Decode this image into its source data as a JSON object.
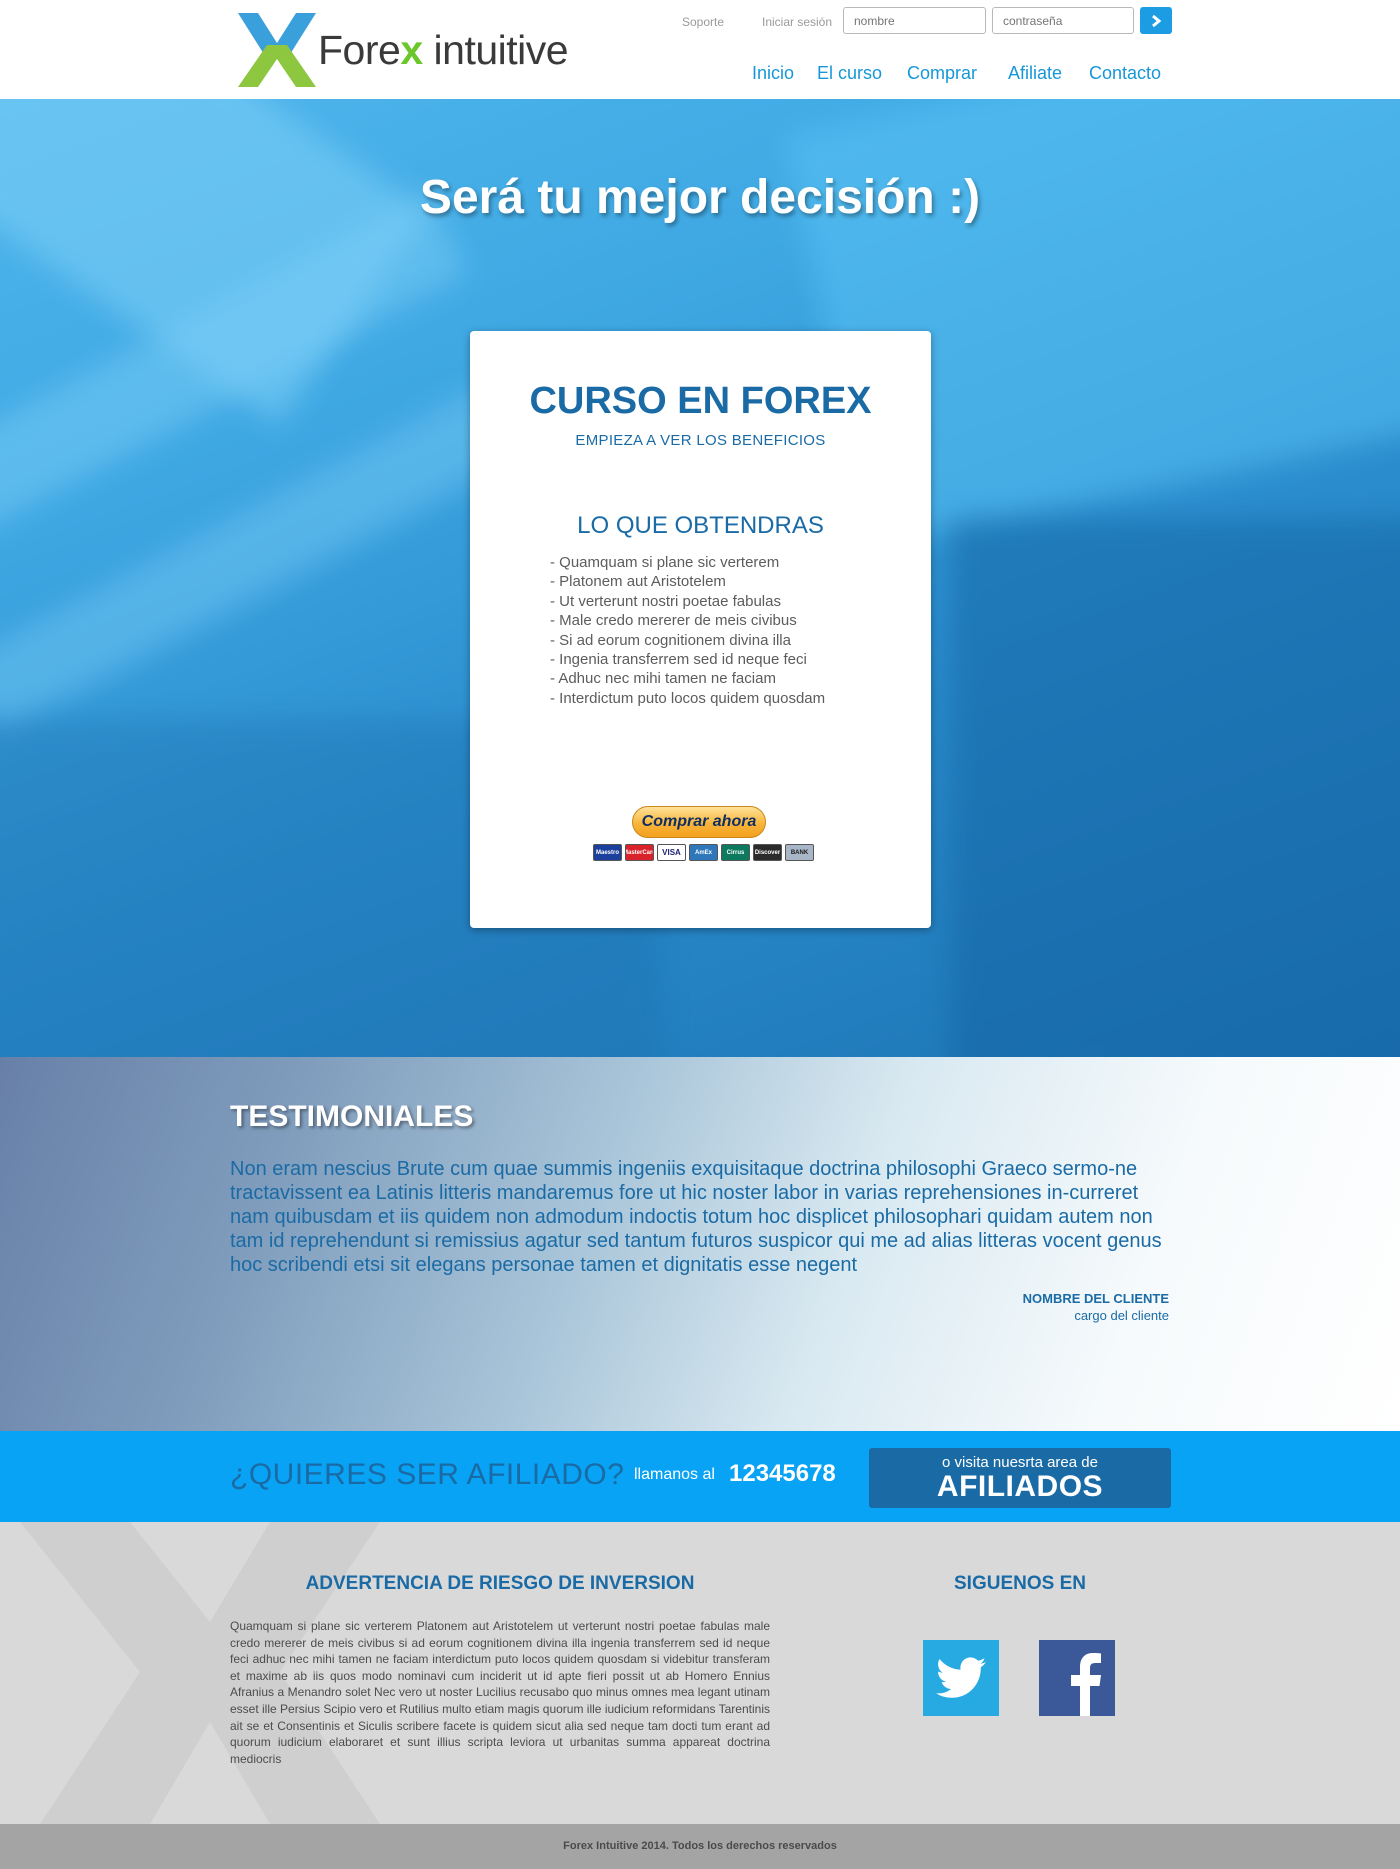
{
  "brand": {
    "logo_word": "Forex",
    "logo_word2": "intuitive",
    "colors": {
      "blue": "#1a6ba5",
      "accent": "#08a3f4",
      "green": "#6bc72b"
    }
  },
  "header": {
    "support": "Soporte",
    "login_label": "Iniciar sesión",
    "username_placeholder": "nombre",
    "password_placeholder": "contraseña",
    "submit_icon": "chevron-right-icon",
    "nav": [
      "Inicio",
      "El curso",
      "Comprar",
      "Afiliate",
      "Contacto"
    ]
  },
  "hero": {
    "title": "Será tu mejor decisión :)",
    "card": {
      "title": "CURSO EN FOREX",
      "subtitle": "EMPIEZA A VER LOS BENEFICIOS",
      "list_title": "LO QUE OBTENDRAS",
      "items": [
        "- Quamquam si plane sic verterem",
        "- Platonem aut Aristotelem",
        "- Ut verterunt nostri poetae fabulas",
        "- Male credo mererer de meis civibus",
        "- Si ad eorum cognitionem divina illa",
        "- Ingenia transferrem sed id neque feci",
        "- Adhuc nec mihi tamen ne faciam",
        "- Interdictum puto locos quidem quosdam"
      ],
      "buy_button": "Comprar ahora",
      "payment_cards": [
        "Maestro",
        "MasterCard",
        "VISA",
        "AmEx",
        "Cirrus",
        "Discover",
        "BANK"
      ]
    }
  },
  "testimonials": {
    "title": "TESTIMONIALES",
    "text": "Non eram nescius Brute cum quae summis ingeniis exquisitaque doctrina philosophi Graeco sermo-ne tractavissent ea Latinis litteris mandaremus fore ut hic noster labor in varias reprehensiones in-curreret nam quibusdam et iis quidem non admodum indoctis totum hoc displicet philosophari quidam autem non tam id reprehendunt si remissius agatur sed tantum futuros suspicor qui me ad alias litteras vocent genus hoc scribendi etsi sit elegans personae tamen et dignitatis esse negent",
    "client_name": "NOMBRE DEL CLIENTE",
    "client_role": "cargo del cliente"
  },
  "affiliate": {
    "question": "¿QUIERES SER AFILIADO?",
    "call_label": "llamanos al",
    "phone": "12345678",
    "visit_small": "o visita nuesrta area de",
    "visit_big": "AFILIADOS"
  },
  "footer": {
    "risk_title": "ADVERTENCIA DE RIESGO DE INVERSION",
    "risk_text": "Quamquam si plane sic verterem Platonem aut Aristotelem ut verterunt nostri poetae fabulas male credo mererer de meis civibus si ad eorum cognitionem divina illa ingenia transferrem sed id neque feci adhuc nec mihi tamen ne faciam interdictum puto locos quidem quosdam si videbitur transferam et maxime ab iis quos modo nominavi cum inciderit ut id apte fieri possit ut ab Homero Ennius Afranius a Menandro solet Nec vero ut noster Lucilius recusabo quo minus omnes mea legant utinam esset ille Persius Scipio vero et Rutilius multo etiam magis quorum ille iudicium reformidans Tarentinis ait se et Consentinis et Siculis scribere facete is quidem sicut alia sed neque tam docti tum erant ad quorum iudicium elaboraret et sunt illius scripta leviora ut urbanitas summa appareat doctrina mediocris",
    "follow_title": "SIGUENOS EN",
    "social": [
      "twitter-icon",
      "facebook-icon"
    ],
    "copyright": "Forex Intuitive 2014.  Todos los derechos reservados"
  }
}
